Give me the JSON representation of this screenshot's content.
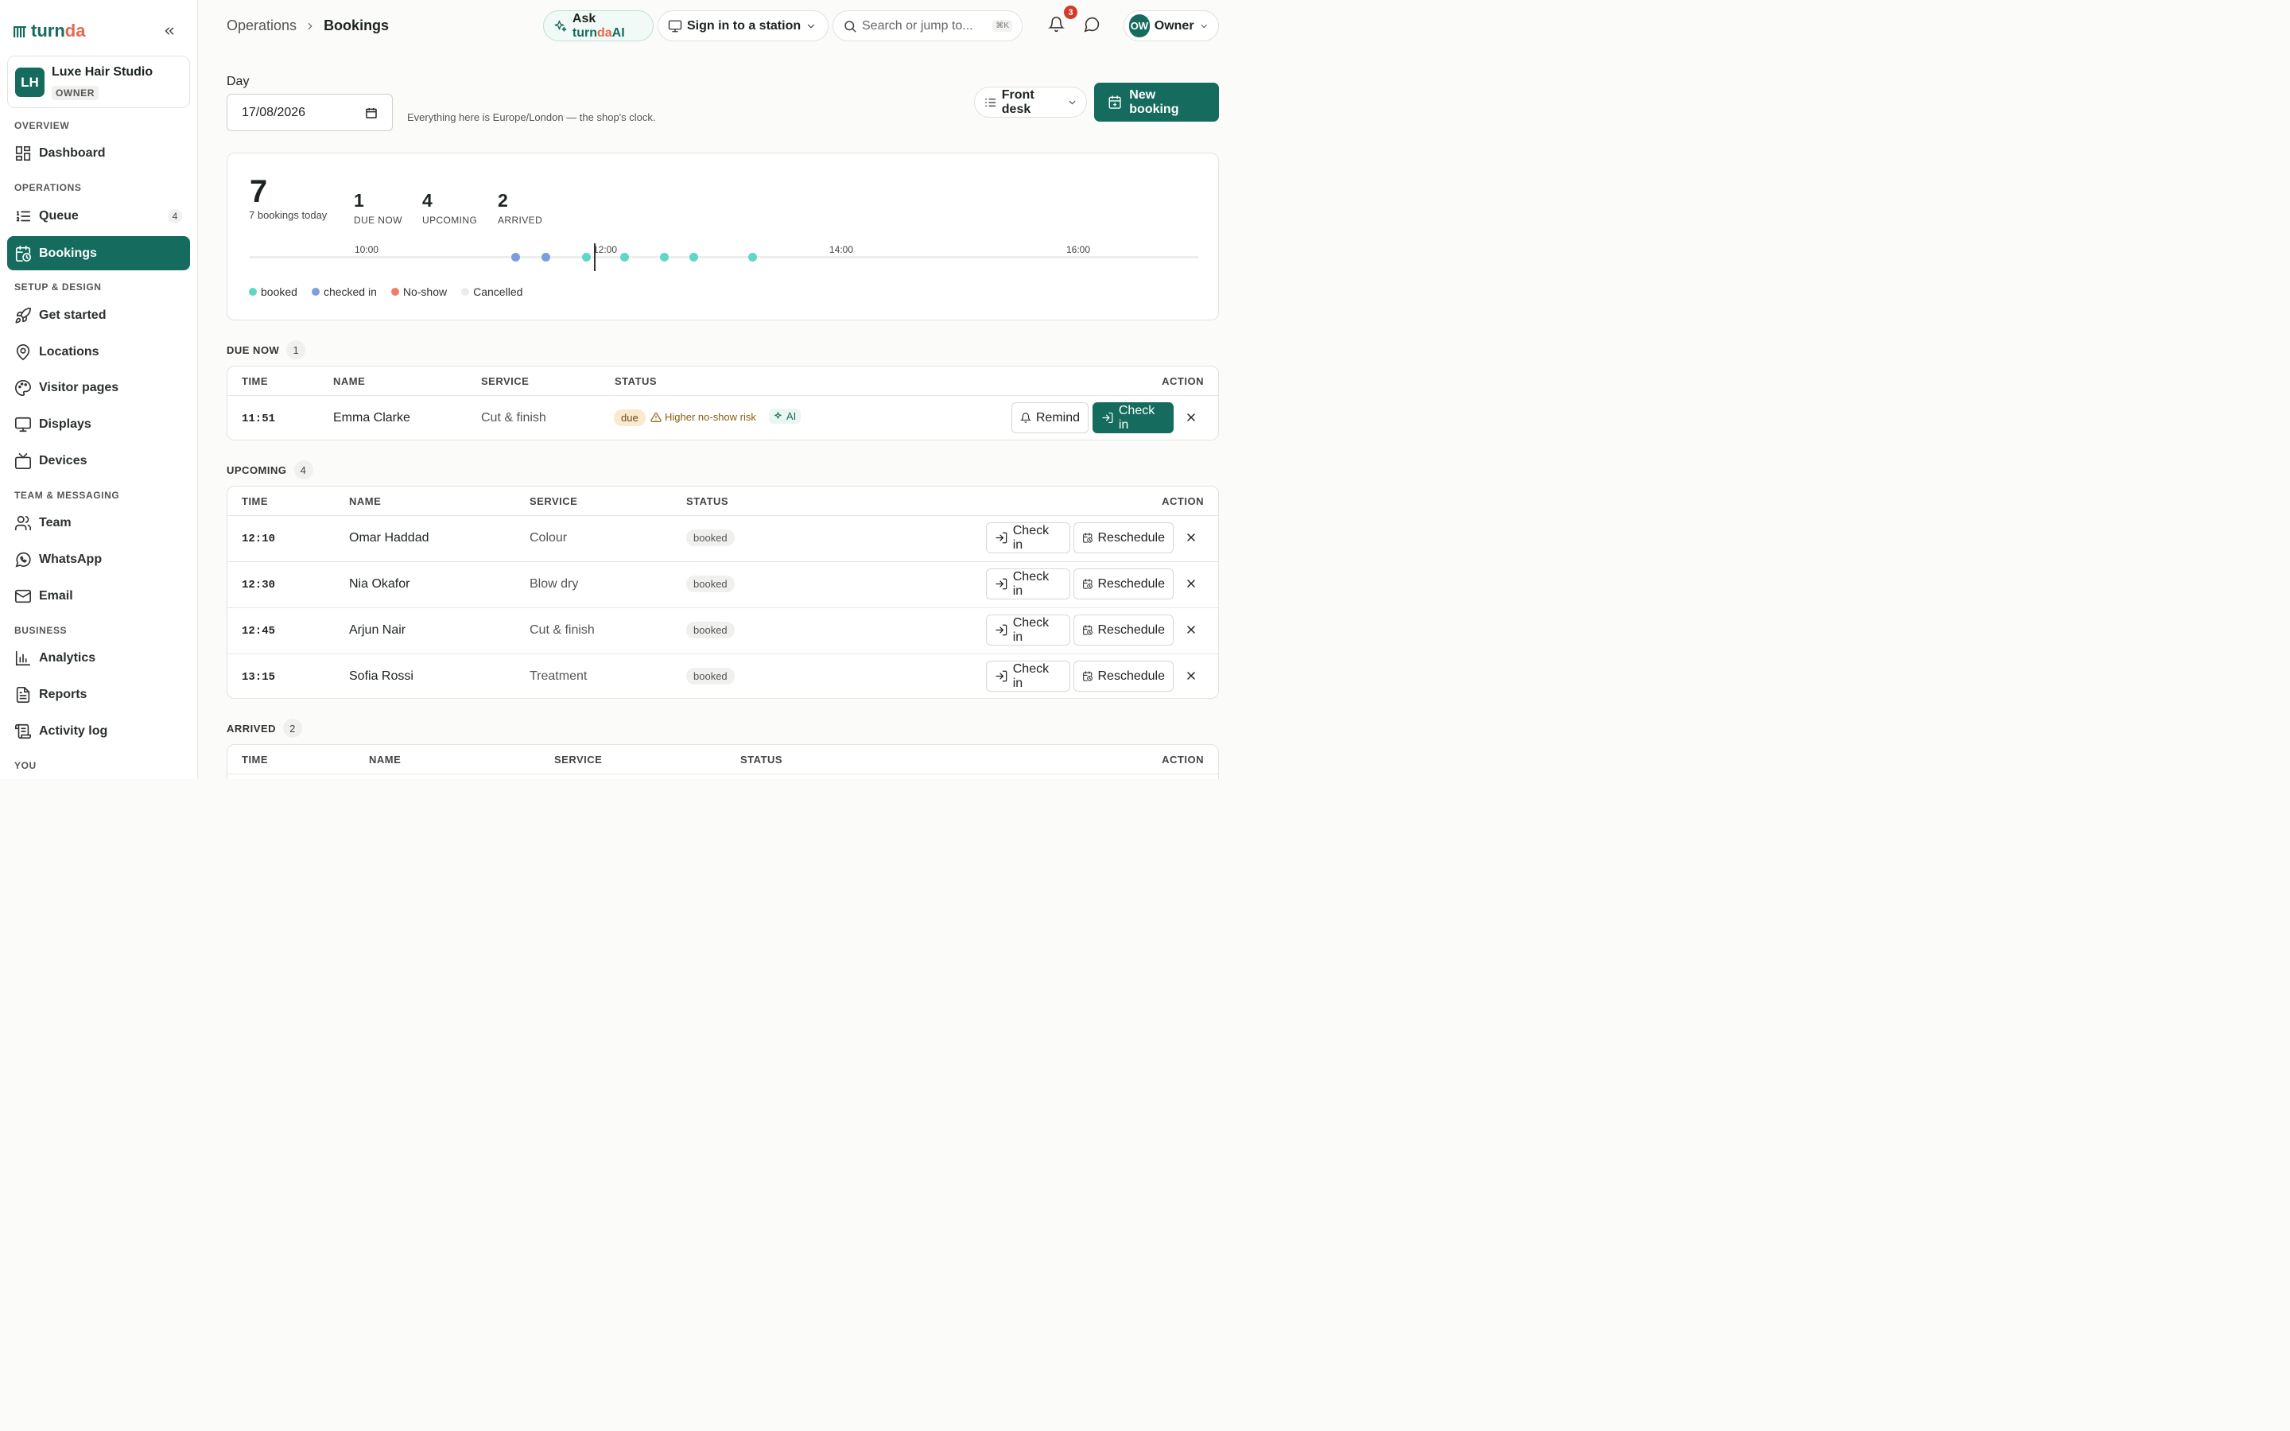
{
  "brand": {
    "logo_a": "turn",
    "logo_b": "da"
  },
  "workspace": {
    "initials": "LH",
    "name": "Luxe Hair Studio",
    "role": "OWNER"
  },
  "sidebar": {
    "sections": {
      "overview": "OVERVIEW",
      "operations": "OPERATIONS",
      "setup": "SETUP & DESIGN",
      "team": "TEAM & MESSAGING",
      "business": "BUSINESS",
      "you": "YOU"
    },
    "items": {
      "dashboard": "Dashboard",
      "queue": "Queue",
      "queue_count": "4",
      "bookings": "Bookings",
      "get_started": "Get started",
      "locations": "Locations",
      "visitor_pages": "Visitor pages",
      "displays": "Displays",
      "devices": "Devices",
      "team": "Team",
      "whatsapp": "WhatsApp",
      "email": "Email",
      "analytics": "Analytics",
      "reports": "Reports",
      "activity_log": "Activity log"
    }
  },
  "header": {
    "crumb_parent": "Operations",
    "crumb_current": "Bookings",
    "ask_prefix": "Ask ",
    "ask_brand_a": "turn",
    "ask_brand_b": "da",
    "ask_brand_c": "AI",
    "station": "Sign in to a station",
    "search_placeholder": "Search or jump to...",
    "shortcut": "⌘K",
    "notifications": "3",
    "owner_initials": "OW",
    "owner_label": "Owner"
  },
  "controls": {
    "day_label": "Day",
    "date_value": "17/08/2026",
    "tz_hint": "Everything here is Europe/London — the shop's clock.",
    "view_label": "Front desk",
    "new_booking": "New booking"
  },
  "summary": {
    "total": "7",
    "total_label": "7 bookings today",
    "stats": [
      {
        "n": "1",
        "label": "DUE NOW"
      },
      {
        "n": "4",
        "label": "UPCOMING"
      },
      {
        "n": "2",
        "label": "ARRIVED"
      }
    ],
    "timeline": {
      "ticks": [
        "10:00",
        "12:00",
        "14:00",
        "16:00"
      ],
      "legend": [
        "booked",
        "checked in",
        "No-show",
        "Cancelled"
      ],
      "colors": {
        "booked": "#5fd6c6",
        "checked_in": "#7a9ee0",
        "no_show": "#f07a6a",
        "cancelled": "#ececea"
      }
    }
  },
  "groups": {
    "due_now": {
      "title": "DUE NOW",
      "count": "1"
    },
    "upcoming": {
      "title": "UPCOMING",
      "count": "4"
    },
    "arrived": {
      "title": "ARRIVED",
      "count": "2"
    }
  },
  "columns": {
    "time": "TIME",
    "name": "NAME",
    "service": "SERVICE",
    "status": "STATUS",
    "action": "ACTION"
  },
  "due_rows": [
    {
      "time": "11:51",
      "name": "Emma Clarke",
      "service": "Cut & finish",
      "status": "due",
      "risk": "Higher no-show risk",
      "ai": "AI"
    }
  ],
  "upcoming_rows": [
    {
      "time": "12:10",
      "name": "Omar Haddad",
      "service": "Colour",
      "status": "booked"
    },
    {
      "time": "12:30",
      "name": "Nia Okafor",
      "service": "Blow dry",
      "status": "booked"
    },
    {
      "time": "12:45",
      "name": "Arjun Nair",
      "service": "Cut & finish",
      "status": "booked"
    },
    {
      "time": "13:15",
      "name": "Sofia Rossi",
      "service": "Treatment",
      "status": "booked"
    }
  ],
  "actions": {
    "remind": "Remind",
    "check_in": "Check in",
    "reschedule": "Reschedule"
  }
}
